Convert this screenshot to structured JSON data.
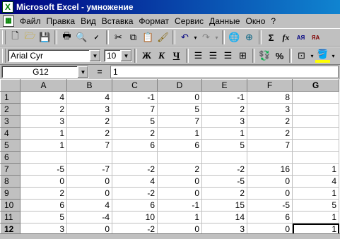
{
  "window": {
    "title": "Microsoft Excel - умножение"
  },
  "menu": [
    "Файл",
    "Правка",
    "Вид",
    "Вставка",
    "Формат",
    "Сервис",
    "Данные",
    "Окно",
    "?"
  ],
  "toolbar_standard": {
    "sum_symbol": "Σ",
    "function_symbol": "fx",
    "sort_asc_label": "АЯ",
    "sort_desc_label": "ЯА"
  },
  "toolbar_format": {
    "font_name": "Arial Cyr",
    "font_size": "10",
    "bold_label": "Ж",
    "italic_label": "К",
    "underline_label": "Ч",
    "percent_label": "%"
  },
  "formula_bar": {
    "name_box": "G12",
    "equals": "=",
    "value": "1"
  },
  "sheet": {
    "columns": [
      "A",
      "B",
      "C",
      "D",
      "E",
      "F",
      "G"
    ],
    "active_column": "G",
    "active_row": "12",
    "rows": [
      {
        "num": "1",
        "cells": [
          "4",
          "4",
          "-1",
          "0",
          "-1",
          "8",
          ""
        ]
      },
      {
        "num": "2",
        "cells": [
          "2",
          "3",
          "7",
          "5",
          "2",
          "3",
          ""
        ]
      },
      {
        "num": "3",
        "cells": [
          "3",
          "2",
          "5",
          "7",
          "3",
          "2",
          ""
        ]
      },
      {
        "num": "4",
        "cells": [
          "1",
          "2",
          "2",
          "1",
          "1",
          "2",
          ""
        ]
      },
      {
        "num": "5",
        "cells": [
          "1",
          "7",
          "6",
          "6",
          "5",
          "7",
          ""
        ]
      },
      {
        "num": "6",
        "cells": [
          "",
          "",
          "",
          "",
          "",
          "",
          ""
        ]
      },
      {
        "num": "7",
        "cells": [
          "-5",
          "-7",
          "-2",
          "2",
          "-2",
          "16",
          "1"
        ]
      },
      {
        "num": "8",
        "cells": [
          "0",
          "0",
          "4",
          "0",
          "-5",
          "0",
          "4"
        ]
      },
      {
        "num": "9",
        "cells": [
          "2",
          "0",
          "-2",
          "0",
          "2",
          "0",
          "1"
        ]
      },
      {
        "num": "10",
        "cells": [
          "6",
          "4",
          "6",
          "-1",
          "15",
          "-5",
          "5"
        ]
      },
      {
        "num": "11",
        "cells": [
          "5",
          "-4",
          "10",
          "1",
          "14",
          "6",
          "1"
        ]
      },
      {
        "num": "12",
        "cells": [
          "3",
          "0",
          "-2",
          "0",
          "3",
          "0",
          "1"
        ]
      }
    ]
  }
}
